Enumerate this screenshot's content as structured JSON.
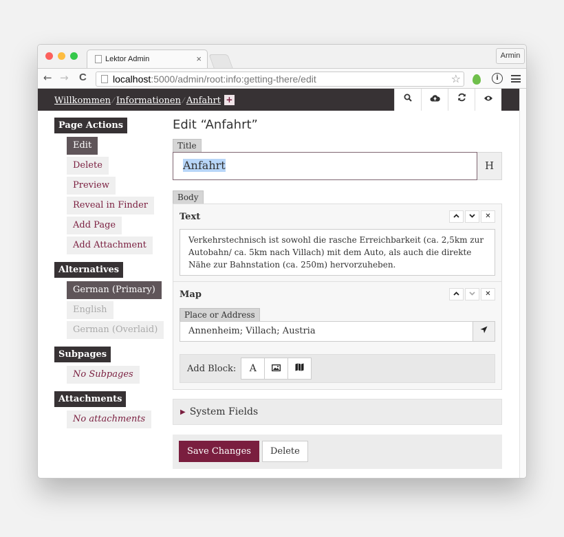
{
  "browser": {
    "tab_title": "Lektor Admin",
    "tab_close": "×",
    "user": "Armin",
    "url_host": "localhost",
    "url_rest": ":5000/admin/root:info:getting-there/edit",
    "back": "←",
    "forward": "→",
    "reload": "C",
    "star": "☆"
  },
  "header": {
    "crumbs": [
      "Willkommen",
      "Informationen",
      "Anfahrt"
    ],
    "sep": "⁄",
    "plus": "+",
    "icons": [
      "search-icon",
      "cloud-upload-icon",
      "refresh-icon",
      "eye-icon"
    ],
    "glyphs": [
      "🔍",
      "☁",
      "⟳",
      "👁"
    ]
  },
  "sidebar": {
    "page_actions": {
      "title": "Page Actions",
      "items": [
        "Edit",
        "Delete",
        "Preview",
        "Reveal in Finder",
        "Add Page",
        "Add Attachment"
      ]
    },
    "alternatives": {
      "title": "Alternatives",
      "items": [
        "German (Primary)",
        "English",
        "German (Overlaid)"
      ]
    },
    "subpages": {
      "title": "Subpages",
      "empty": "No Subpages"
    },
    "attachments": {
      "title": "Attachments",
      "empty": "No attachments"
    }
  },
  "main": {
    "page_title": "Edit “Anfahrt”",
    "title_label": "Title",
    "title_value": "Anfahrt",
    "title_btn": "H",
    "body_label": "Body",
    "text_block": {
      "title": "Text",
      "content": "Verkehrstechnisch ist sowohl die rasche Erreichbarkeit (ca. 2,5km zur Autobahn/ ca. 5km nach Villach) mit dem Auto, als auch die direkte Nähe zur Bahnstation (ca. 250m) hervorzuheben."
    },
    "map_block": {
      "title": "Map",
      "place_label": "Place or Address",
      "place_value": "Annenheim; Villach; Austria"
    },
    "block_btns": [
      "^",
      "v",
      "✕"
    ],
    "add_block": {
      "label": "Add Block:",
      "buttons": [
        "A",
        "▣",
        "▥"
      ]
    },
    "system_fields": "System Fields",
    "save": "Save Changes",
    "delete": "Delete"
  },
  "colors": {
    "accent": "#7a1e3f",
    "dark": "#373234",
    "active": "#5f5559"
  }
}
